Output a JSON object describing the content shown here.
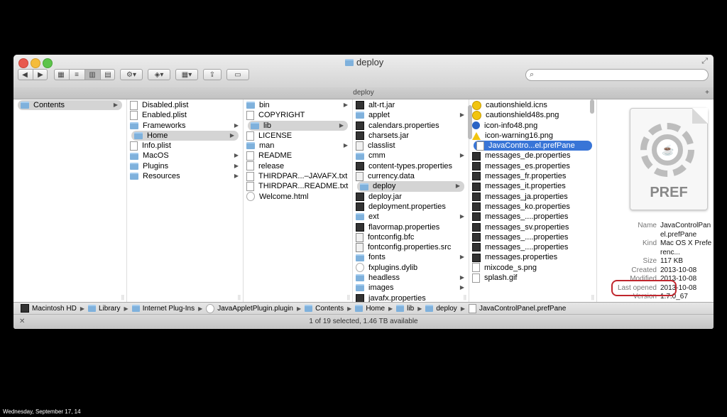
{
  "window": {
    "title": "deploy",
    "path_tab": "deploy"
  },
  "toolbar": {
    "back_icon": "back-icon",
    "forward_icon": "forward-icon",
    "search_placeholder": ""
  },
  "columns": [
    {
      "items": [
        {
          "label": "Contents",
          "icon": "folder",
          "arrow": true,
          "selected": "gray"
        }
      ]
    },
    {
      "items": [
        {
          "label": "Disabled.plist",
          "icon": "file"
        },
        {
          "label": "Enabled.plist",
          "icon": "file"
        },
        {
          "label": "Frameworks",
          "icon": "folder",
          "arrow": true
        },
        {
          "label": "Home",
          "icon": "folder",
          "arrow": true,
          "selected": "gray"
        },
        {
          "label": "Info.plist",
          "icon": "file"
        },
        {
          "label": "MacOS",
          "icon": "folder",
          "arrow": true
        },
        {
          "label": "Plugins",
          "icon": "folder",
          "arrow": true
        },
        {
          "label": "Resources",
          "icon": "folder",
          "arrow": true
        }
      ]
    },
    {
      "items": [
        {
          "label": "bin",
          "icon": "folder",
          "arrow": true
        },
        {
          "label": "COPYRIGHT",
          "icon": "file"
        },
        {
          "label": "lib",
          "icon": "folder",
          "arrow": true,
          "selected": "gray"
        },
        {
          "label": "LICENSE",
          "icon": "file"
        },
        {
          "label": "man",
          "icon": "folder",
          "arrow": true
        },
        {
          "label": "README",
          "icon": "file"
        },
        {
          "label": "release",
          "icon": "file"
        },
        {
          "label": "THIRDPAR...–JAVAFX.txt",
          "icon": "file"
        },
        {
          "label": "THIRDPAR...README.txt",
          "icon": "file"
        },
        {
          "label": "Welcome.html",
          "icon": "web"
        }
      ]
    },
    {
      "items": [
        {
          "label": "alt-rt.jar",
          "icon": "exec"
        },
        {
          "label": "applet",
          "icon": "folder",
          "arrow": true
        },
        {
          "label": "calendars.properties",
          "icon": "exec"
        },
        {
          "label": "charsets.jar",
          "icon": "exec"
        },
        {
          "label": "classlist",
          "icon": "doc"
        },
        {
          "label": "cmm",
          "icon": "folder",
          "arrow": true
        },
        {
          "label": "content-types.properties",
          "icon": "exec"
        },
        {
          "label": "currency.data",
          "icon": "doc"
        },
        {
          "label": "deploy",
          "icon": "folder",
          "arrow": true,
          "selected": "gray"
        },
        {
          "label": "deploy.jar",
          "icon": "exec"
        },
        {
          "label": "deployment.properties",
          "icon": "exec"
        },
        {
          "label": "ext",
          "icon": "folder",
          "arrow": true
        },
        {
          "label": "flavormap.properties",
          "icon": "exec"
        },
        {
          "label": "fontconfig.bfc",
          "icon": "doc"
        },
        {
          "label": "fontconfig.properties.src",
          "icon": "doc"
        },
        {
          "label": "fonts",
          "icon": "folder",
          "arrow": true
        },
        {
          "label": "fxplugins.dylib",
          "icon": "web"
        },
        {
          "label": "headless",
          "icon": "folder",
          "arrow": true
        },
        {
          "label": "images",
          "icon": "folder",
          "arrow": true
        },
        {
          "label": "javafx.properties",
          "icon": "exec"
        }
      ]
    },
    {
      "items": [
        {
          "label": "cautionshield.icns",
          "icon": "bang"
        },
        {
          "label": "cautionshield48s.png",
          "icon": "bang"
        },
        {
          "label": "icon-info48.png",
          "icon": "info"
        },
        {
          "label": "icon-warning16.png",
          "icon": "warn"
        },
        {
          "label": "JavaContro...el.prefPane",
          "icon": "file",
          "selected": "blue"
        },
        {
          "label": "messages_de.properties",
          "icon": "exec"
        },
        {
          "label": "messages_es.properties",
          "icon": "exec"
        },
        {
          "label": "messages_fr.properties",
          "icon": "exec"
        },
        {
          "label": "messages_it.properties",
          "icon": "exec"
        },
        {
          "label": "messages_ja.properties",
          "icon": "exec"
        },
        {
          "label": "messages_ko.properties",
          "icon": "exec"
        },
        {
          "label": "messages_....properties",
          "icon": "exec"
        },
        {
          "label": "messages_sv.properties",
          "icon": "exec"
        },
        {
          "label": "messages_....properties",
          "icon": "exec"
        },
        {
          "label": "messages_....properties",
          "icon": "exec"
        },
        {
          "label": "messages.properties",
          "icon": "exec"
        },
        {
          "label": "mixcode_s.png",
          "icon": "file"
        },
        {
          "label": "splash.gif",
          "icon": "file"
        }
      ]
    }
  ],
  "preview": {
    "icon_text": "PREF",
    "meta": [
      {
        "key": "Name",
        "value": "JavaControlPanel.prefPane"
      },
      {
        "key": "Kind",
        "value": "Mac OS X Preferenc..."
      },
      {
        "key": "Size",
        "value": "117 KB"
      },
      {
        "key": "Created",
        "value": "2013-10-08"
      },
      {
        "key": "Modified",
        "value": "2013-10-08"
      },
      {
        "key": "Last opened",
        "value": "2013-10-08"
      },
      {
        "key": "Version",
        "value": "1.7.0_67"
      }
    ]
  },
  "pathbar": [
    {
      "label": "Macintosh HD",
      "icon": "hd"
    },
    {
      "label": "Library",
      "icon": "folder"
    },
    {
      "label": "Internet Plug-Ins",
      "icon": "folder"
    },
    {
      "label": "JavaAppletPlugin.plugin",
      "icon": "web"
    },
    {
      "label": "Contents",
      "icon": "folder"
    },
    {
      "label": "Home",
      "icon": "folder"
    },
    {
      "label": "lib",
      "icon": "folder"
    },
    {
      "label": "deploy",
      "icon": "folder"
    },
    {
      "label": "JavaControlPanel.prefPane",
      "icon": "file"
    }
  ],
  "status": "1 of 19 selected, 1.46 TB available",
  "footer": "Wednesday, September 17, 14"
}
